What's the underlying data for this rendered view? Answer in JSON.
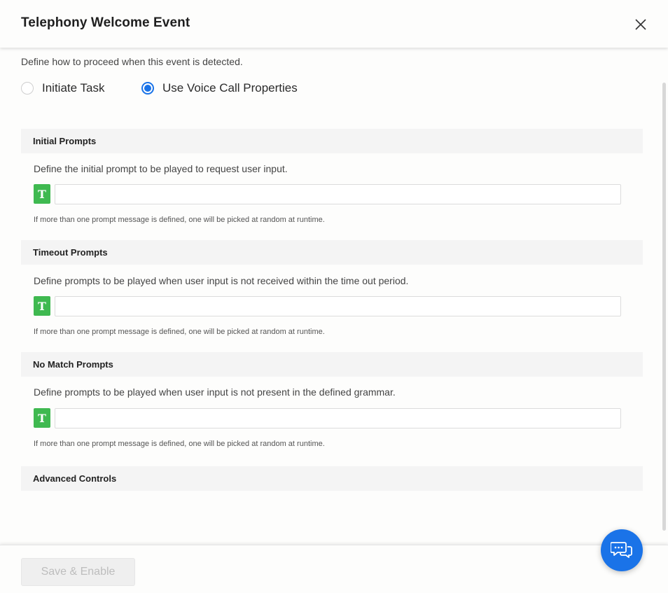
{
  "dialog": {
    "title": "Telephony Welcome Event"
  },
  "main": {
    "description": "Define how to proceed when this event is detected.",
    "options": [
      {
        "label": "Initiate Task",
        "selected": false
      },
      {
        "label": "Use Voice Call Properties",
        "selected": true
      }
    ],
    "sections": [
      {
        "title": "Initial Prompts",
        "description": "Define the initial prompt to be played to request user input.",
        "badge": "T",
        "input_value": "",
        "hint": "If more than one prompt message is defined, one will be picked at random at runtime."
      },
      {
        "title": "Timeout Prompts",
        "description": "Define prompts to be played when user input is not received within the time out period.",
        "badge": "T",
        "input_value": "",
        "hint": "If more than one prompt message is defined, one will be picked at random at runtime."
      },
      {
        "title": "No Match Prompts",
        "description": "Define prompts to be played when user input is not present in the defined grammar.",
        "badge": "T",
        "input_value": "",
        "hint": "If more than one prompt message is defined, one will be picked at random at runtime."
      }
    ],
    "advanced": {
      "title": "Advanced Controls"
    }
  },
  "footer": {
    "save_label": "Save & Enable"
  },
  "icons": {
    "close": "close-icon",
    "chat": "chat-bubbles-icon"
  },
  "colors": {
    "accent": "#1a73e8",
    "badge": "#3fb950",
    "section_bg": "#f4f4f4"
  }
}
